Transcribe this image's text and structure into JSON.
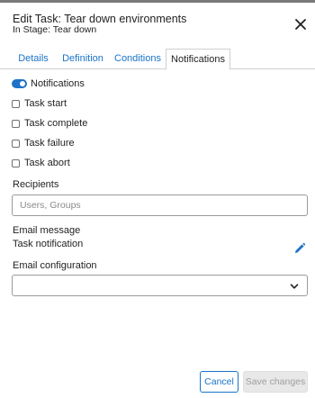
{
  "dialog": {
    "title": "Edit Task: Tear down environments",
    "subtitle": "In Stage: Tear down",
    "close_icon": "close-icon"
  },
  "tabs": [
    {
      "label": "Details",
      "active": false
    },
    {
      "label": "Definition",
      "active": false
    },
    {
      "label": "Conditions",
      "active": false
    },
    {
      "label": "Notifications",
      "active": true
    }
  ],
  "notifications": {
    "toggle_label": "Notifications",
    "enabled": true,
    "events": [
      {
        "label": "Task start",
        "checked": false
      },
      {
        "label": "Task complete",
        "checked": false
      },
      {
        "label": "Task failure",
        "checked": false
      },
      {
        "label": "Task abort",
        "checked": false
      }
    ]
  },
  "recipients": {
    "label": "Recipients",
    "value": "",
    "placeholder": "Users, Groups"
  },
  "email_message": {
    "label": "Email message",
    "template_name": "Task notification",
    "edit_icon": "pencil-icon"
  },
  "email_configuration": {
    "label": "Email configuration",
    "selected": "",
    "chevron_icon": "chevron-down-icon"
  },
  "footer": {
    "cancel_label": "Cancel",
    "save_label": "Save changes",
    "save_enabled": false
  },
  "colors": {
    "accent": "#1a73c8",
    "disabled_bg": "#e8e8e8",
    "disabled_text": "#9e9e9e"
  }
}
